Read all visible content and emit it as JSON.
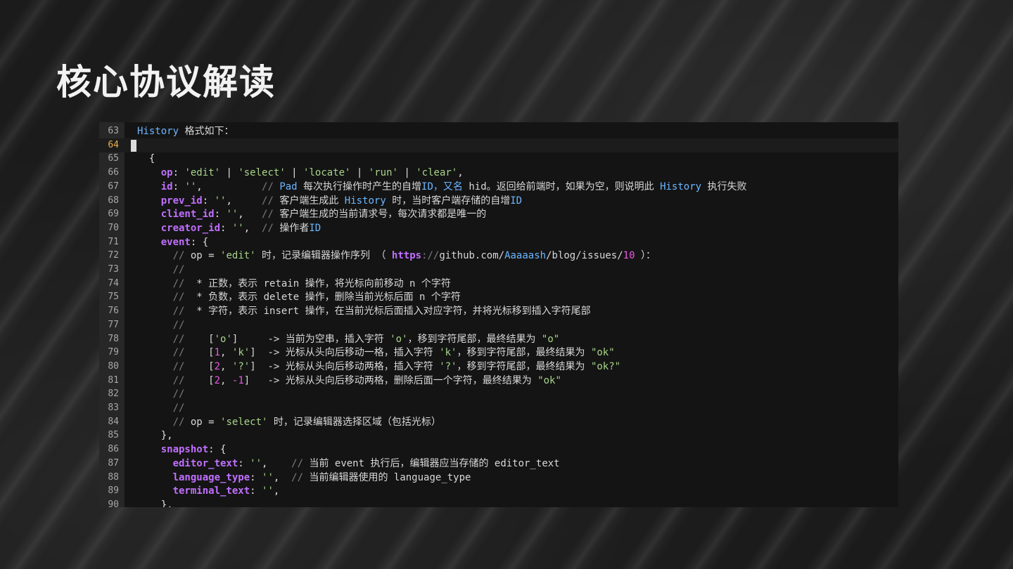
{
  "slide": {
    "title": "核心协议解读"
  },
  "editor": {
    "active_line": "64",
    "lines": [
      {
        "no": "63",
        "parts": [
          [
            "b",
            "History"
          ],
          [
            "t",
            " 格式如下："
          ]
        ]
      },
      {
        "no": "64",
        "parts": []
      },
      {
        "no": "65",
        "parts": [
          [
            "o",
            "  {"
          ]
        ]
      },
      {
        "no": "66",
        "parts": [
          [
            "o",
            "    "
          ],
          [
            "k",
            "op"
          ],
          [
            "o",
            ": "
          ],
          [
            "s",
            "'edit'"
          ],
          [
            "o",
            " | "
          ],
          [
            "s",
            "'select'"
          ],
          [
            "o",
            " | "
          ],
          [
            "s",
            "'locate'"
          ],
          [
            "o",
            " | "
          ],
          [
            "s",
            "'run'"
          ],
          [
            "o",
            " | "
          ],
          [
            "s",
            "'clear'"
          ],
          [
            "o",
            ","
          ]
        ]
      },
      {
        "no": "67",
        "parts": [
          [
            "o",
            "    "
          ],
          [
            "k",
            "id"
          ],
          [
            "o",
            ": "
          ],
          [
            "s",
            "''"
          ],
          [
            "o",
            ",          "
          ],
          [
            "c",
            "// "
          ],
          [
            "b",
            "Pad"
          ],
          [
            "t",
            " 每次执行操作时产生的自增"
          ],
          [
            "b",
            "ID，又名"
          ],
          [
            "t",
            " hid。返回给前端时，如果为空，则说明此 "
          ],
          [
            "b",
            "History"
          ],
          [
            "t",
            " 执行失败"
          ]
        ]
      },
      {
        "no": "68",
        "parts": [
          [
            "o",
            "    "
          ],
          [
            "k",
            "prev_id"
          ],
          [
            "o",
            ": "
          ],
          [
            "s",
            "''"
          ],
          [
            "o",
            ",     "
          ],
          [
            "c",
            "// "
          ],
          [
            "t",
            "客户端生成此 "
          ],
          [
            "b",
            "History"
          ],
          [
            "t",
            " 时，当时客户端存储的自增"
          ],
          [
            "b",
            "ID"
          ]
        ]
      },
      {
        "no": "69",
        "parts": [
          [
            "o",
            "    "
          ],
          [
            "k",
            "client_id"
          ],
          [
            "o",
            ": "
          ],
          [
            "s",
            "''"
          ],
          [
            "o",
            ",   "
          ],
          [
            "c",
            "// "
          ],
          [
            "t",
            "客户端生成的当前请求号，每次请求都是唯一的"
          ]
        ]
      },
      {
        "no": "70",
        "parts": [
          [
            "o",
            "    "
          ],
          [
            "k",
            "creator_id"
          ],
          [
            "o",
            ": "
          ],
          [
            "s",
            "''"
          ],
          [
            "o",
            ",  "
          ],
          [
            "c",
            "// "
          ],
          [
            "t",
            "操作者"
          ],
          [
            "b",
            "ID"
          ]
        ]
      },
      {
        "no": "71",
        "parts": [
          [
            "o",
            "    "
          ],
          [
            "k",
            "event"
          ],
          [
            "o",
            ": {"
          ]
        ]
      },
      {
        "no": "72",
        "parts": [
          [
            "o",
            "      "
          ],
          [
            "c",
            "// "
          ],
          [
            "t",
            "op = "
          ],
          [
            "s",
            "'edit'"
          ],
          [
            "t",
            " 时，记录编辑器操作序列 （ "
          ],
          [
            "k",
            "https"
          ],
          [
            "c",
            "://"
          ],
          [
            "t",
            "github.com/"
          ],
          [
            "b",
            "Aaaaash"
          ],
          [
            "t",
            "/blog/issues/"
          ],
          [
            "n",
            "10"
          ],
          [
            "t",
            " ）："
          ]
        ]
      },
      {
        "no": "73",
        "parts": [
          [
            "o",
            "      "
          ],
          [
            "c",
            "//"
          ]
        ]
      },
      {
        "no": "74",
        "parts": [
          [
            "o",
            "      "
          ],
          [
            "c",
            "//"
          ],
          [
            "t",
            "  * 正数，表示 retain 操作，将光标向前移动 n 个字符"
          ]
        ]
      },
      {
        "no": "75",
        "parts": [
          [
            "o",
            "      "
          ],
          [
            "c",
            "//"
          ],
          [
            "t",
            "  * 负数，表示 delete 操作，删除当前光标后面 n 个字符"
          ]
        ]
      },
      {
        "no": "76",
        "parts": [
          [
            "o",
            "      "
          ],
          [
            "c",
            "//"
          ],
          [
            "t",
            "  * 字符，表示 insert 操作，在当前光标后面插入对应字符，并将光标移到插入字符尾部"
          ]
        ]
      },
      {
        "no": "77",
        "parts": [
          [
            "o",
            "      "
          ],
          [
            "c",
            "//"
          ]
        ]
      },
      {
        "no": "78",
        "parts": [
          [
            "o",
            "      "
          ],
          [
            "c",
            "//"
          ],
          [
            "t",
            "    ["
          ],
          [
            "s",
            "'o'"
          ],
          [
            "t",
            "]     -> 当前为空串，插入字符 "
          ],
          [
            "s",
            "'o'"
          ],
          [
            "t",
            "，移到字符尾部，最终结果为 "
          ],
          [
            "s",
            "\"o\""
          ]
        ]
      },
      {
        "no": "79",
        "parts": [
          [
            "o",
            "      "
          ],
          [
            "c",
            "//"
          ],
          [
            "t",
            "    ["
          ],
          [
            "n",
            "1"
          ],
          [
            "t",
            ", "
          ],
          [
            "s",
            "'k'"
          ],
          [
            "t",
            "]  -> 光标从头向后移动一格，插入字符 "
          ],
          [
            "s",
            "'k'"
          ],
          [
            "t",
            "，移到字符尾部，最终结果为 "
          ],
          [
            "s",
            "\"ok\""
          ]
        ]
      },
      {
        "no": "80",
        "parts": [
          [
            "o",
            "      "
          ],
          [
            "c",
            "//"
          ],
          [
            "t",
            "    ["
          ],
          [
            "n",
            "2"
          ],
          [
            "t",
            ", "
          ],
          [
            "s",
            "'?'"
          ],
          [
            "t",
            "]  -> 光标从头向后移动两格，插入字符 "
          ],
          [
            "s",
            "'?'"
          ],
          [
            "t",
            "，移到字符尾部，最终结果为 "
          ],
          [
            "s",
            "\"ok?\""
          ]
        ]
      },
      {
        "no": "81",
        "parts": [
          [
            "o",
            "      "
          ],
          [
            "c",
            "//"
          ],
          [
            "t",
            "    ["
          ],
          [
            "n",
            "2"
          ],
          [
            "t",
            ", "
          ],
          [
            "n",
            "-1"
          ],
          [
            "t",
            "]   -> 光标从头向后移动两格，删除后面一个字符，最终结果为 "
          ],
          [
            "s",
            "\"ok\""
          ]
        ]
      },
      {
        "no": "82",
        "parts": [
          [
            "o",
            "      "
          ],
          [
            "c",
            "//"
          ]
        ]
      },
      {
        "no": "83",
        "parts": [
          [
            "o",
            "      "
          ],
          [
            "c",
            "//"
          ]
        ]
      },
      {
        "no": "84",
        "parts": [
          [
            "o",
            "      "
          ],
          [
            "c",
            "// "
          ],
          [
            "t",
            "op = "
          ],
          [
            "s",
            "'select'"
          ],
          [
            "t",
            " 时，记录编辑器选择区域（包括光标）"
          ]
        ]
      },
      {
        "no": "85",
        "parts": [
          [
            "o",
            "    },"
          ]
        ]
      },
      {
        "no": "86",
        "parts": [
          [
            "o",
            "    "
          ],
          [
            "k",
            "snapshot"
          ],
          [
            "o",
            ": {"
          ]
        ]
      },
      {
        "no": "87",
        "parts": [
          [
            "o",
            "      "
          ],
          [
            "k",
            "editor_text"
          ],
          [
            "o",
            ": "
          ],
          [
            "s",
            "''"
          ],
          [
            "o",
            ",    "
          ],
          [
            "c",
            "// "
          ],
          [
            "t",
            "当前 event 执行后，编辑器应当存储的 editor_text"
          ]
        ]
      },
      {
        "no": "88",
        "parts": [
          [
            "o",
            "      "
          ],
          [
            "k",
            "language_type"
          ],
          [
            "o",
            ": "
          ],
          [
            "s",
            "''"
          ],
          [
            "o",
            ",  "
          ],
          [
            "c",
            "// "
          ],
          [
            "t",
            "当前编辑器使用的 language_type"
          ]
        ]
      },
      {
        "no": "89",
        "parts": [
          [
            "o",
            "      "
          ],
          [
            "k",
            "terminal_text"
          ],
          [
            "o",
            ": "
          ],
          [
            "s",
            "''"
          ],
          [
            "o",
            ","
          ]
        ]
      },
      {
        "no": "90",
        "parts": [
          [
            "o",
            "    },"
          ]
        ]
      }
    ]
  }
}
